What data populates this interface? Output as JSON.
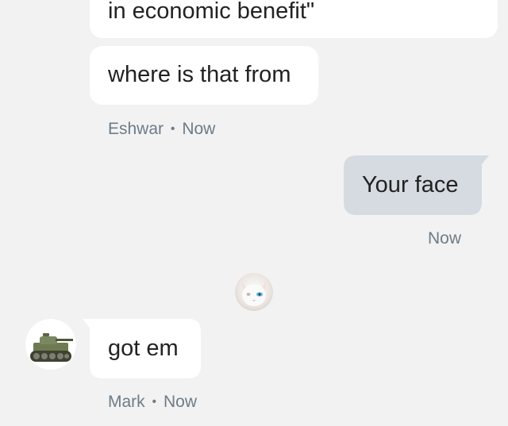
{
  "messages": [
    {
      "sender": "",
      "text": "in economic benefit\"",
      "direction": "incoming"
    },
    {
      "sender": "Eshwar",
      "text": "where is that from",
      "direction": "incoming",
      "time": "Now"
    },
    {
      "sender": "",
      "text": "Your face",
      "direction": "outgoing",
      "time": "Now"
    },
    {
      "sender": "Mark",
      "text": "got em",
      "direction": "incoming",
      "time": "Now"
    }
  ],
  "separator": "•",
  "read_receipt_avatar": "cat-avatar-icon",
  "mark_avatar": "tank-avatar-icon",
  "colors": {
    "background": "#f2f2f2",
    "incoming_bubble": "#ffffff",
    "outgoing_bubble": "#d5dbe0",
    "meta_text": "#6e7c87"
  }
}
